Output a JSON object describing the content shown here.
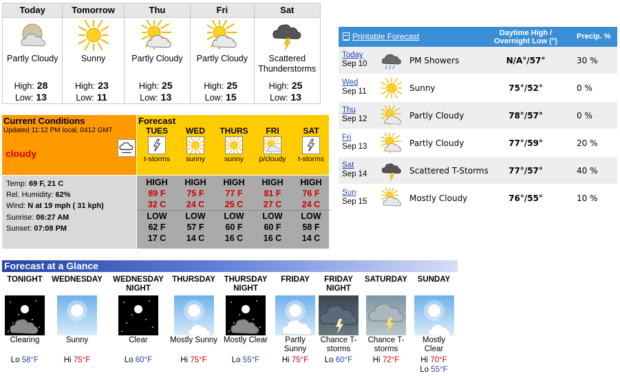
{
  "summary": {
    "labels": {
      "high": "High:",
      "low": "Low:"
    },
    "days": [
      {
        "name": "Today",
        "icon": "partly-cloudy-night-icon",
        "condition": "Partly Cloudy",
        "high": "28",
        "low": "13"
      },
      {
        "name": "Tomorrow",
        "icon": "sunny-icon",
        "condition": "Sunny",
        "high": "23",
        "low": "11"
      },
      {
        "name": "Thu",
        "icon": "partly-cloudy-icon",
        "condition": "Partly Cloudy",
        "high": "25",
        "low": "13"
      },
      {
        "name": "Fri",
        "icon": "partly-cloudy-icon",
        "condition": "Partly Cloudy",
        "high": "25",
        "low": "15"
      },
      {
        "name": "Sat",
        "icon": "thunderstorm-icon",
        "condition": "Scattered Thunderstorms",
        "high": "25",
        "low": "13"
      }
    ]
  },
  "printable": {
    "link": "Printable Forecast",
    "col_temp": "Daytime High / Overnight Low (°)",
    "col_precip": "Precip. %",
    "rows": [
      {
        "day": "Today",
        "date": "Sep 10",
        "icon": "showers-icon",
        "condition": "PM Showers",
        "temp": "N/A°/57°",
        "precip": "30 %"
      },
      {
        "day": "Wed",
        "date": "Sep 11",
        "icon": "sunny-icon",
        "condition": "Sunny",
        "temp": "75°/52°",
        "precip": "0 %"
      },
      {
        "day": "Thu",
        "date": "Sep 12",
        "icon": "partly-cloudy-icon",
        "condition": "Partly Cloudy",
        "temp": "78°/57°",
        "precip": "0 %"
      },
      {
        "day": "Fri",
        "date": "Sep 13",
        "icon": "partly-cloudy-icon",
        "condition": "Partly Cloudy",
        "temp": "77°/59°",
        "precip": "20 %"
      },
      {
        "day": "Sat",
        "date": "Sep 14",
        "icon": "thunderstorm-icon",
        "condition": "Scattered T-Storms",
        "temp": "77°/57°",
        "precip": "40 %"
      },
      {
        "day": "Sun",
        "date": "Sep 15",
        "icon": "mostly-cloudy-icon",
        "condition": "Mostly Cloudy",
        "temp": "76°/55°",
        "precip": "10 %"
      }
    ]
  },
  "current": {
    "title": "Current Conditions",
    "updated": "Updated 11:12 PM local, 0412 GMT",
    "condition": "cloudy",
    "icon": "cloudy-icon",
    "temp_label": "Temp:",
    "temp": "69 F, 21 C",
    "humidity_label": "Rel. Humidity:",
    "humidity": "62%",
    "wind_label": "Wind:",
    "wind": "N at 19 mph ( 31 kph)",
    "sunrise_label": "Sunrise:",
    "sunrise": "06:27 AM",
    "sunset_label": "Sunset:",
    "sunset": "07:08 PM"
  },
  "forecast": {
    "title": "Forecast",
    "high_label": "HIGH",
    "low_label": "LOW",
    "days": [
      {
        "name": "TUES",
        "icon": "lightning-icon",
        "label": "t-storms",
        "high_f": "89 F",
        "high_c": "32 C",
        "low_f": "62 F",
        "low_c": "17 C"
      },
      {
        "name": "WED",
        "icon": "sun-icon",
        "label": "sunny",
        "high_f": "75 F",
        "high_c": "24 C",
        "low_f": "57 F",
        "low_c": "14 C"
      },
      {
        "name": "THURS",
        "icon": "sun-icon",
        "label": "sunny",
        "high_f": "77 F",
        "high_c": "25 C",
        "low_f": "60 F",
        "low_c": "16 C"
      },
      {
        "name": "FRI",
        "icon": "partly-cloudy-icon",
        "label": "p/cloudy",
        "high_f": "81 F",
        "high_c": "27 C",
        "low_f": "60 F",
        "low_c": "16 C"
      },
      {
        "name": "SAT",
        "icon": "lightning-icon",
        "label": "t-storms",
        "high_f": "76 F",
        "high_c": "24 C",
        "low_f": "58 F",
        "low_c": "14 C"
      }
    ]
  },
  "glance": {
    "title": "Forecast at a Glance",
    "periods": [
      {
        "name": "TONIGHT",
        "img": "clearing-night",
        "condition": "Clearing",
        "temps": [
          {
            "label": "Lo",
            "value": "58°F",
            "kind": "lo"
          }
        ]
      },
      {
        "name": "WEDNESDAY",
        "img": "sunny-day",
        "condition": "Sunny",
        "temps": [
          {
            "label": "Hi",
            "value": "75°F",
            "kind": "hi"
          }
        ]
      },
      {
        "name": "WEDNESDAY NIGHT",
        "img": "clear-night",
        "condition": "Clear",
        "temps": [
          {
            "label": "Lo",
            "value": "60°F",
            "kind": "lo"
          }
        ]
      },
      {
        "name": "THURSDAY",
        "img": "mostly-sunny-day",
        "condition": "Mostly Sunny",
        "temps": [
          {
            "label": "Hi",
            "value": "75°F",
            "kind": "hi"
          }
        ]
      },
      {
        "name": "THURSDAY NIGHT",
        "img": "mostly-clear-night",
        "condition": "Mostly Clear",
        "temps": [
          {
            "label": "Lo",
            "value": "55°F",
            "kind": "lo"
          }
        ]
      },
      {
        "name": "FRIDAY",
        "img": "partly-sunny-day",
        "condition": "Partly Sunny",
        "temps": [
          {
            "label": "Hi",
            "value": "75°F",
            "kind": "hi"
          }
        ]
      },
      {
        "name": "FRIDAY NIGHT",
        "img": "tstorm-night",
        "condition": "Chance T-storms",
        "temps": [
          {
            "label": "Lo",
            "value": "60°F",
            "kind": "lo"
          }
        ]
      },
      {
        "name": "SATURDAY",
        "img": "tstorm-day",
        "condition": "Chance T-storms",
        "temps": [
          {
            "label": "Hi",
            "value": "72°F",
            "kind": "hi"
          }
        ]
      },
      {
        "name": "SUNDAY",
        "img": "mostly-clear-day",
        "condition": "Mostly Clear",
        "temps": [
          {
            "label": "Hi",
            "value": "70°F",
            "kind": "hi"
          },
          {
            "label": "Lo",
            "value": "55°F",
            "kind": "lo"
          }
        ]
      }
    ]
  }
}
